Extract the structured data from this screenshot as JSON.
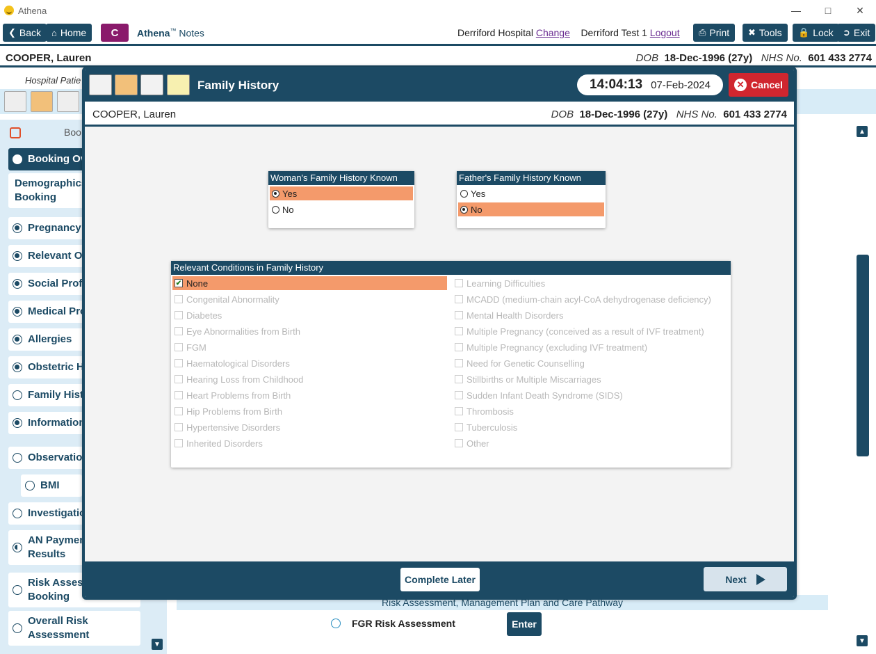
{
  "app": {
    "title": "Athena"
  },
  "toolbar": {
    "back": "Back",
    "home": "Home",
    "c_label": "C",
    "brand": "Athena",
    "brand_tm": "™",
    "brand_sub": "Notes",
    "hospital": "Derriford Hospital",
    "change": "Change",
    "user": "Derriford Test 1",
    "logout": "Logout",
    "print": "Print",
    "tools": "Tools",
    "lock": "Lock",
    "exit": "Exit"
  },
  "patient": {
    "name": "COOPER, Lauren",
    "dob_label": "DOB",
    "dob": "18-Dec-1996 (27y)",
    "nhs_label": "NHS No.",
    "nhs": "601 433 2774"
  },
  "subheader": "Hospital Patie",
  "sidebar": {
    "header": "Boo",
    "items": [
      {
        "label": "Booking Ov",
        "state": "empty"
      },
      {
        "label": "Demographics\nBooking",
        "state": "none"
      },
      {
        "label": "Pregnancy P",
        "state": "filled"
      },
      {
        "label": "Relevant Ot",
        "state": "filled"
      },
      {
        "label": "Social Profil",
        "state": "filled"
      },
      {
        "label": "Medical Pro",
        "state": "filled"
      },
      {
        "label": "Allergies",
        "state": "filled"
      },
      {
        "label": "Obstetric Hi",
        "state": "filled"
      },
      {
        "label": "Family Histo",
        "state": "empty"
      },
      {
        "label": "Information",
        "state": "filled"
      },
      {
        "label": "Observation",
        "state": "empty"
      },
      {
        "label": "BMI",
        "state": "empty"
      },
      {
        "label": "Investigatio",
        "state": "empty"
      },
      {
        "label": "AN Paymen\nResults",
        "state": "half"
      },
      {
        "label": "Risk Assess\nBooking",
        "state": "empty"
      },
      {
        "label": "Overall Risk\nAssessment",
        "state": "empty"
      }
    ]
  },
  "background": {
    "band": "Risk Assessment, Management Plan and Care Pathway",
    "fgr": "FGR Risk Assessment",
    "enter": "Enter"
  },
  "modal": {
    "title": "Family History",
    "time": "14:04:13",
    "date": "07-Feb-2024",
    "cancel": "Cancel",
    "woman_panel": {
      "title": "Woman's Family History Known",
      "options": [
        "Yes",
        "No"
      ],
      "selected": "Yes"
    },
    "father_panel": {
      "title": "Father's Family History Known",
      "options": [
        "Yes",
        "No"
      ],
      "selected": "No"
    },
    "conditions": {
      "title": "Relevant Conditions in Family History",
      "left": [
        "None",
        "Congenital Abnormality",
        "Diabetes",
        "Eye Abnormalities from Birth",
        "FGM",
        "Haematological Disorders",
        "Hearing Loss from Childhood",
        "Heart Problems from Birth",
        "Hip Problems from Birth",
        "Hypertensive Disorders",
        "Inherited Disorders"
      ],
      "right": [
        "Learning Difficulties",
        "MCADD (medium-chain acyl-CoA dehydrogenase deficiency)",
        "Mental Health Disorders",
        "Multiple Pregnancy (conceived as a result of IVF treatment)",
        "Multiple Pregnancy (excluding IVF treatment)",
        "Need for Genetic Counselling",
        "Stillbirths or Multiple Miscarriages",
        "Sudden Infant Death Syndrome (SIDS)",
        "Thrombosis",
        "Tuberculosis",
        "Other"
      ],
      "checked": "None"
    },
    "complete_later": "Complete Later",
    "next": "Next"
  }
}
